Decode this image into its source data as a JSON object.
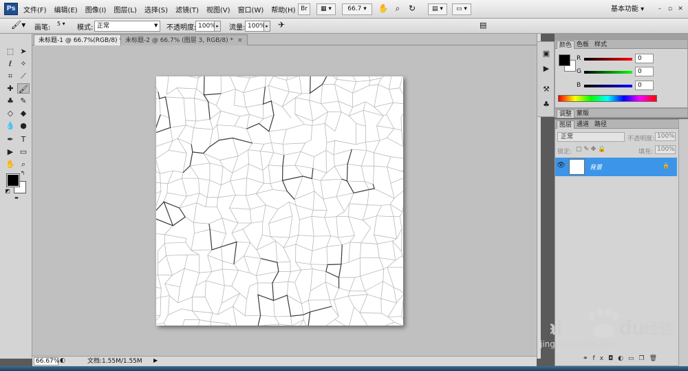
{
  "app": {
    "logo": "Ps"
  },
  "menu": [
    "文件(F)",
    "编辑(E)",
    "图像(I)",
    "图层(L)",
    "选择(S)",
    "滤镜(T)",
    "视图(V)",
    "窗口(W)",
    "帮助(H)"
  ],
  "menubar_controls": {
    "bridge": "Br",
    "zoom": "66.7",
    "workspace": "基本功能",
    "min": "–",
    "restore": "▫",
    "close": "✕"
  },
  "options": {
    "brush_label": "画笔:",
    "brush_size": "5",
    "mode_label": "模式:",
    "mode_value": "正常",
    "opacity_label": "不透明度:",
    "opacity_value": "100%",
    "flow_label": "流量:",
    "flow_value": "100%"
  },
  "tabs": [
    {
      "label": "未标题-1 @ 66.7%(RGB/8) *",
      "close": "×"
    },
    {
      "label": "未标题-2 @ 66.7% (图层 3, RGB/8) *",
      "close": "×"
    }
  ],
  "status": {
    "zoom": "66.67%",
    "doc": "文档:1.55M/1.55M"
  },
  "color_panel": {
    "tabs": [
      "颜色",
      "色板",
      "样式"
    ],
    "r_label": "R",
    "g_label": "G",
    "b_label": "B",
    "r": "0",
    "g": "0",
    "b": "0"
  },
  "adjust_panel": {
    "tabs": [
      "调整",
      "蒙版"
    ]
  },
  "layers_panel": {
    "tabs": [
      "图层",
      "通道",
      "路径"
    ],
    "blend_mode": "正常",
    "opacity_label": "不透明度:",
    "opacity": "100%",
    "lock_label": "锁定:",
    "fill_label": "填充:",
    "fill": "100%",
    "layer_name": "背景"
  },
  "watermark": {
    "text": "jingyan.baidu.com"
  },
  "colors": {
    "selected_layer": "#3c95e8",
    "canvas_bg": "#c0c0c0"
  }
}
